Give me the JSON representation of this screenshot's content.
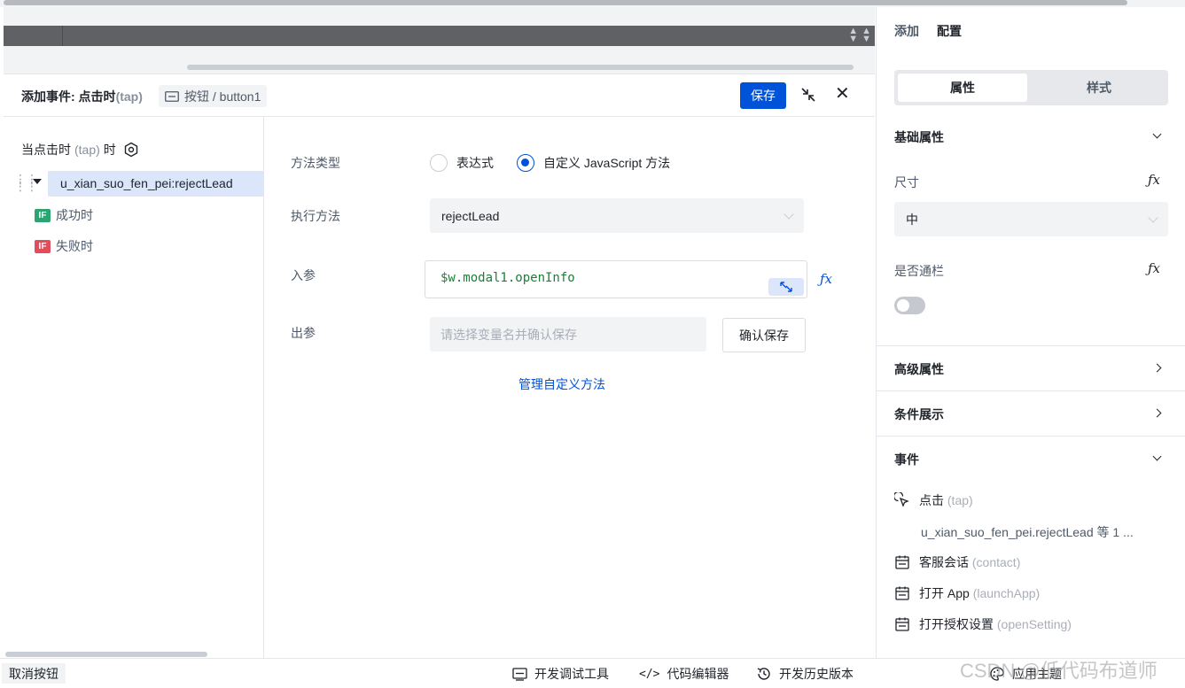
{
  "modal": {
    "title_prefix": "添加事件: 点击时",
    "title_tap": "(tap)",
    "breadcrumb": "按钮 / button1",
    "save_label": "保存",
    "close_glyph": "✕"
  },
  "left": {
    "trigger_prefix": "当点击时",
    "trigger_tap": "(tap)",
    "trigger_suffix": "时",
    "tree_item": "u_xian_suo_fen_pei:rejectLead",
    "branch_success_badge": "IF",
    "branch_success": "成功时",
    "branch_fail_badge": "IF",
    "branch_fail": "失败时"
  },
  "form": {
    "method_type_label": "方法类型",
    "radio_expression": "表达式",
    "radio_custom_js": "自定义 JavaScript 方法",
    "selected_radio": "自定义 JavaScript 方法",
    "exec_method_label": "执行方法",
    "exec_method_value": "rejectLead",
    "input_param_label": "入参",
    "input_param_value": "$w.modal1.openInfo",
    "fx_label": "ƒx",
    "output_param_label": "出参",
    "output_placeholder": "请选择变量名并确认保存",
    "confirm_save_label": "确认保存",
    "manage_link": "管理自定义方法"
  },
  "bottom": {
    "cancel_chip": "取消按钮",
    "dev_tools": "开发调试工具",
    "code_editor": "代码编辑器",
    "history": "开发历史版本",
    "apply_theme": "应用主题",
    "watermark": "CSDN @低代码布道师"
  },
  "right": {
    "tabs": [
      "添加",
      "配置"
    ],
    "active_tab": "配置",
    "segments": [
      "属性",
      "样式"
    ],
    "active_segment": "属性",
    "basic_props": "基础属性",
    "size_label": "尺寸",
    "size_value": "中",
    "fx_label": "ƒx",
    "full_width_label": "是否通栏",
    "full_width_on": false,
    "advanced_props": "高级属性",
    "conditional_display": "条件展示",
    "events": "事件",
    "event_items": [
      {
        "name": "点击",
        "code": "(tap)",
        "icon": "cursor-click-icon"
      },
      {
        "name": "客服会话",
        "code": "(contact)",
        "icon": "calendar-icon"
      },
      {
        "name": "打开 App",
        "code": "(launchApp)",
        "icon": "calendar-icon"
      },
      {
        "name": "打开授权设置",
        "code": "(openSetting)",
        "icon": "calendar-icon"
      }
    ],
    "tap_handler": "u_xian_suo_fen_pei.rejectLead 等 1 ..."
  },
  "colors": {
    "primary": "#0052d9",
    "selected_bg": "#dce6fb",
    "if_success": "#2ba471",
    "if_fail": "#e34d59",
    "code_text": "#1a7f37"
  }
}
